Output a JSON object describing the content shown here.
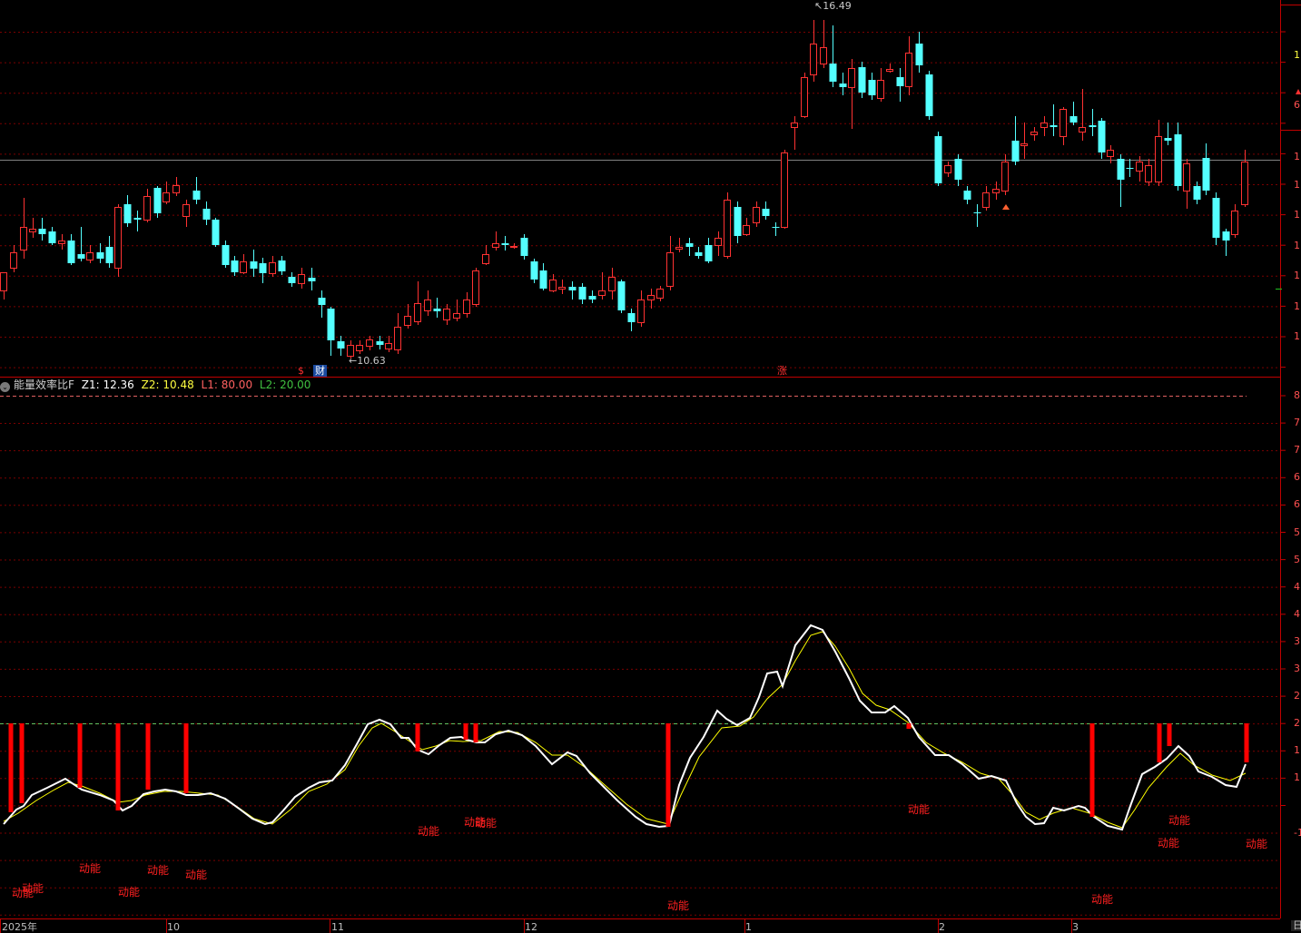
{
  "price_panel": {
    "high_marker": "16.49",
    "low_marker": "10.63",
    "event_tags": [
      "$",
      "财",
      "涨"
    ]
  },
  "indicator": {
    "name": "能量效率比F",
    "fields": [
      {
        "label": "Z1: 12.36",
        "color": "#ffffff"
      },
      {
        "label": "Z2: 10.48",
        "color": "#ffff40"
      },
      {
        "label": "L1: 80.00",
        "color": "#ff6060"
      },
      {
        "label": "L2: 20.00",
        "color": "#40c040"
      }
    ],
    "signal_label": "动能"
  },
  "x_axis": {
    "labels": [
      "2025年",
      "10",
      "11",
      "12",
      "1",
      "2",
      "3"
    ]
  },
  "right_axis": {
    "price_ticks": [
      "1",
      "6",
      "1",
      "1",
      "1",
      "1",
      "1",
      "1",
      "1"
    ],
    "indicator_ticks": [
      "8",
      "7",
      "7",
      "6",
      "6",
      "5",
      "5",
      "4",
      "4",
      "3",
      "3",
      "2",
      "2",
      "1",
      "1",
      "-1"
    ],
    "bottom_tab": "日"
  },
  "colors": {
    "up": "#ff3232",
    "down": "#54ffff",
    "grid": "#7a0000",
    "z1": "#ffffff",
    "z2": "#ffff00",
    "signal": "#ff0000"
  },
  "chart_data": {
    "type": "candlestick",
    "price_extremes": {
      "high": 16.49,
      "low": 10.63
    },
    "indicator_lines": {
      "L1": 80.0,
      "L2": 20.0,
      "Z1_last": 12.36,
      "Z2_last": 10.48
    }
  }
}
